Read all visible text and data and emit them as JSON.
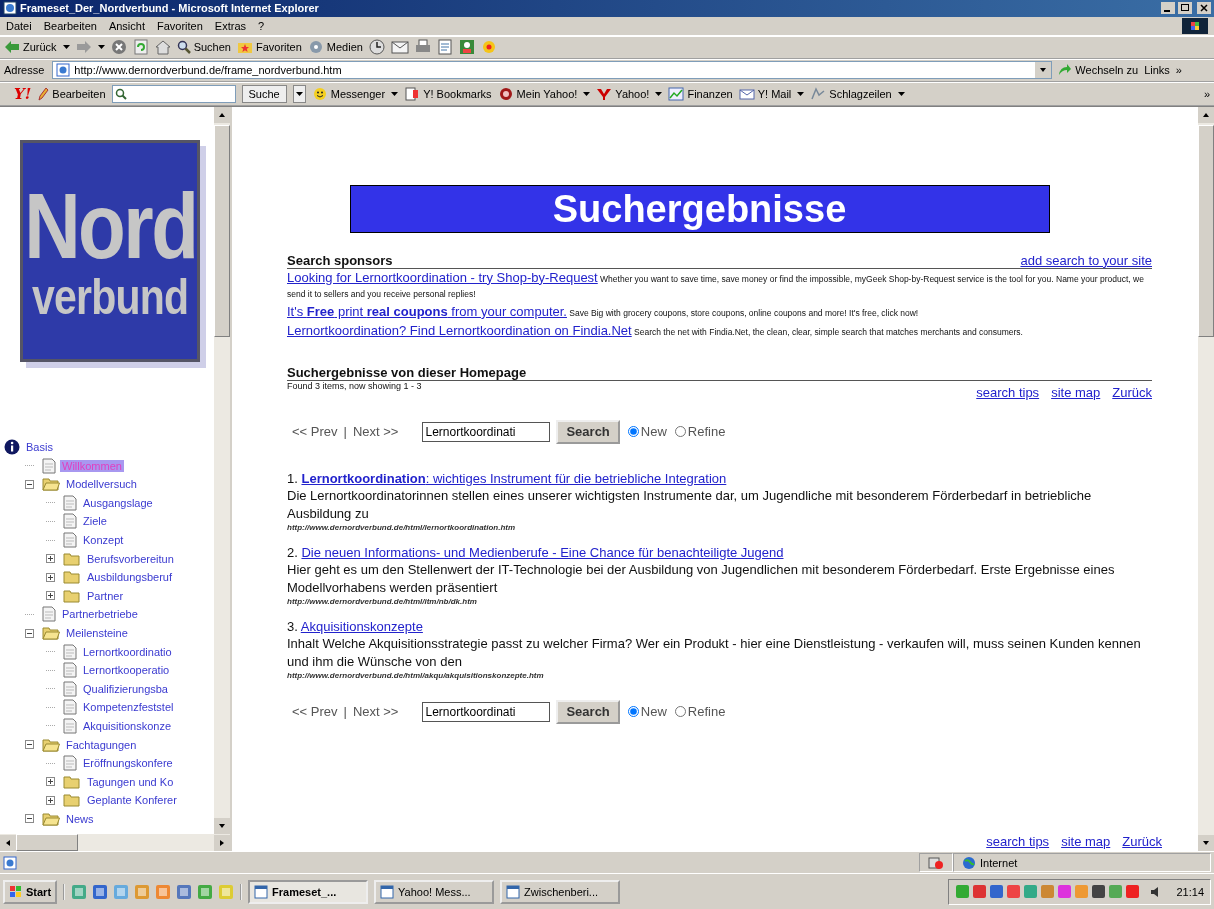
{
  "window": {
    "title": "Frameset_Der_Nordverbund - Microsoft Internet Explorer"
  },
  "menu": [
    "Datei",
    "Bearbeiten",
    "Ansicht",
    "Favoriten",
    "Extras",
    "?"
  ],
  "toolbar": [
    {
      "label": "Zurück",
      "kind": "back"
    },
    {
      "label": "Suchen",
      "kind": "search"
    },
    {
      "label": "Favoriten",
      "kind": "favorites"
    },
    {
      "label": "Medien",
      "kind": "media"
    }
  ],
  "address": {
    "label": "Adresse",
    "url": "http://www.dernordverbund.de/frame_nordverbund.htm",
    "go": "Wechseln zu",
    "links": "Links",
    "more": "»"
  },
  "yahoo_bar": {
    "logo": "Y!",
    "edit": "Bearbeiten",
    "search_button": "Suche",
    "items": [
      "Messenger",
      "Y! Bookmarks",
      "Mein Yahoo!",
      "Yahoo!",
      "Finanzen",
      "Y! Mail",
      "Schlagzeilen"
    ],
    "more": "»"
  },
  "logo": {
    "line_1": "Nord",
    "line_2": "verbund"
  },
  "tree": [
    {
      "label": "Basis",
      "kind": "home",
      "selected": false,
      "children": [
        {
          "label": "Willkommen",
          "kind": "page",
          "selected": true
        },
        {
          "label": "Modellversuch",
          "kind": "folder",
          "selected": false,
          "expanded": true,
          "children": [
            {
              "label": "Ausgangslage",
              "kind": "page",
              "selected": false
            },
            {
              "label": "Ziele",
              "kind": "page",
              "selected": false
            },
            {
              "label": "Konzept",
              "kind": "page",
              "selected": false
            },
            {
              "label": "Berufsvorbereitun",
              "kind": "folder",
              "selected": false,
              "expanded": false
            },
            {
              "label": "Ausbildungsberuf",
              "kind": "folder",
              "selected": false,
              "expanded": false
            },
            {
              "label": "Partner",
              "kind": "folder",
              "selected": false,
              "expanded": false
            }
          ]
        },
        {
          "label": "Partnerbetriebe",
          "kind": "page",
          "selected": false
        },
        {
          "label": "Meilensteine",
          "kind": "folder",
          "selected": false,
          "expanded": true,
          "children": [
            {
              "label": "Lernortkoordinatio",
              "kind": "page",
              "selected": false
            },
            {
              "label": "Lernortkooperatio",
              "kind": "page",
              "selected": false
            },
            {
              "label": "Qualifizierungsba",
              "kind": "page",
              "selected": false
            },
            {
              "label": "Kompetenzfeststel",
              "kind": "page",
              "selected": false
            },
            {
              "label": "Akquisitionskonze",
              "kind": "page",
              "selected": false
            }
          ]
        },
        {
          "label": "Fachtagungen",
          "kind": "folder",
          "selected": false,
          "expanded": true,
          "children": [
            {
              "label": "Eröffnungskonfere",
              "kind": "page",
              "selected": false
            },
            {
              "label": "Tagungen und Ko",
              "kind": "folder",
              "selected": false,
              "expanded": false
            },
            {
              "label": "Geplante Konferer",
              "kind": "folder",
              "selected": false,
              "expanded": false
            }
          ]
        },
        {
          "label": "News",
          "kind": "folder",
          "selected": false,
          "expanded": true
        }
      ]
    }
  ],
  "page": {
    "heading": "Suchergebnisse",
    "sponsors": {
      "title": "Search sponsors",
      "add_link": "add search to your site",
      "ads": [
        {
          "link": "Looking for Lernortkoordination - try Shop-by-Request",
          "text": "Whether you want to save time, save money or find the impossible, myGeek Shop-by-Request service is the tool for you. Name your product, we send it to sellers and you receive personal replies!"
        },
        {
          "link": "It's **Free** print **real coupons** from your computer.",
          "text": "Save Big with grocery coupons, store coupons, online coupons and more! It's free, click now!"
        },
        {
          "link": "Lernortkoordination? Find Lernortkoordination on Findia.Net",
          "text": "Search the net with Findia.Net, the clean, clear, simple search that matches merchants and consumers."
        }
      ]
    },
    "results_title": "Suchergebnisse von dieser Homepage",
    "found": "Found 3 items, now showing 1 - 3",
    "links": [
      "search tips",
      "site map",
      "Zurück"
    ],
    "search_bars": [
      {
        "prev": "<< Prev",
        "sep": "|",
        "next": "Next >>",
        "value": "Lernortkoordinati",
        "button": "Search",
        "options": [
          {
            "label": "New",
            "selected": true
          },
          {
            "label": "Refine",
            "selected": false
          }
        ]
      },
      {
        "prev": "<< Prev",
        "sep": "|",
        "next": "Next >>",
        "value": "Lernortkoordinati",
        "button": "Search",
        "options": [
          {
            "label": "New",
            "selected": true
          },
          {
            "label": "Refine",
            "selected": false
          }
        ]
      }
    ],
    "results": [
      {
        "number": "1.",
        "title": "**Lernortkoordination**: wichtiges Instrument für die betriebliche Integration",
        "text": "Die Lernortkoordinatorinnen stellen eines unserer wichtigsten Instrumente dar, um Jugendliche mit besonderem Förderbedarf in betriebliche Ausbildung zu",
        "url": "http://www.dernordverbund.de/html/lernortkoordination.htm"
      },
      {
        "number": "2.",
        "title": "Die neuen Informations- und Medienberufe - Eine Chance für benachteiligte Jugend",
        "text": "Hier geht es um den Stellenwert der IT-Technologie bei der Ausbildung von Jugendlichen mit besonderem Förderbedarf. Erste Ergebnisse eines Modellvorhabens werden präsentiert",
        "url": "http://www.dernordverbund.de/html/itm/nb/dk.htm"
      },
      {
        "number": "3.",
        "title": "Akquisitionskonzepte",
        "text": "Inhalt Welche Akquisitionsstrategie passt zu welcher Firma? Wer ein Produkt - hier eine Dienstleistung - verkaufen will, muss seinen Kunden kennen und ihm die Wünsche von den",
        "url": "http://www.dernordverbund.de/html/akqu/akquisitionskonzepte.htm"
      }
    ],
    "links_bottom": [
      "search tips",
      "site map",
      "Zurück"
    ]
  },
  "status_bar": {
    "zone": "Internet"
  },
  "taskbar": {
    "start": "Start",
    "tasks": [
      {
        "label": "Frameset_...",
        "selected": true
      },
      {
        "label": "Yahoo! Mess...",
        "selected": false
      },
      {
        "label": "Zwischenberi...",
        "selected": false
      }
    ],
    "clock": "21:14"
  }
}
